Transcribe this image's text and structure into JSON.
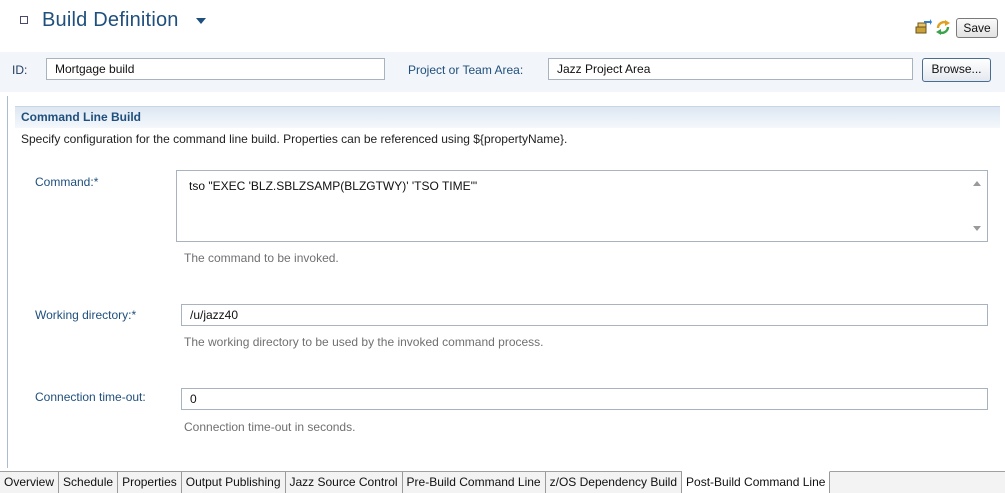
{
  "header": {
    "title": "Build Definition",
    "save_label": "Save",
    "icons": [
      "build-request-icon",
      "refresh-icon"
    ]
  },
  "id_row": {
    "id_label": "ID:",
    "id_value": "Mortgage build",
    "project_label": "Project or Team Area:",
    "project_value": "Jazz Project Area",
    "browse_label": "Browse..."
  },
  "section": {
    "title": "Command Line Build",
    "description": "Specify configuration for the command line build. Properties can be referenced using ${propertyName}."
  },
  "fields": {
    "command": {
      "label": "Command:*",
      "value": "tso \"EXEC 'BLZ.SBLZSAMP(BLZGTWY)' 'TSO TIME'\"",
      "hint": "The command to be invoked."
    },
    "working_directory": {
      "label": "Working directory:*",
      "value": "/u/jazz40",
      "hint": "The working directory to be used by the invoked command process."
    },
    "connection_timeout": {
      "label": "Connection time-out:",
      "value": "0",
      "hint": "Connection time-out in seconds."
    }
  },
  "tabs": [
    {
      "label": "Overview"
    },
    {
      "label": "Schedule"
    },
    {
      "label": "Properties"
    },
    {
      "label": "Output Publishing"
    },
    {
      "label": "Jazz Source Control"
    },
    {
      "label": "Pre-Build Command Line"
    },
    {
      "label": "z/OS Dependency Build"
    },
    {
      "label": "Post-Build Command Line"
    }
  ],
  "active_tab": "Post-Build Command Line",
  "colors": {
    "title": "#1f4f7d",
    "section_bar": "#dde7f2",
    "hint": "#707070"
  }
}
